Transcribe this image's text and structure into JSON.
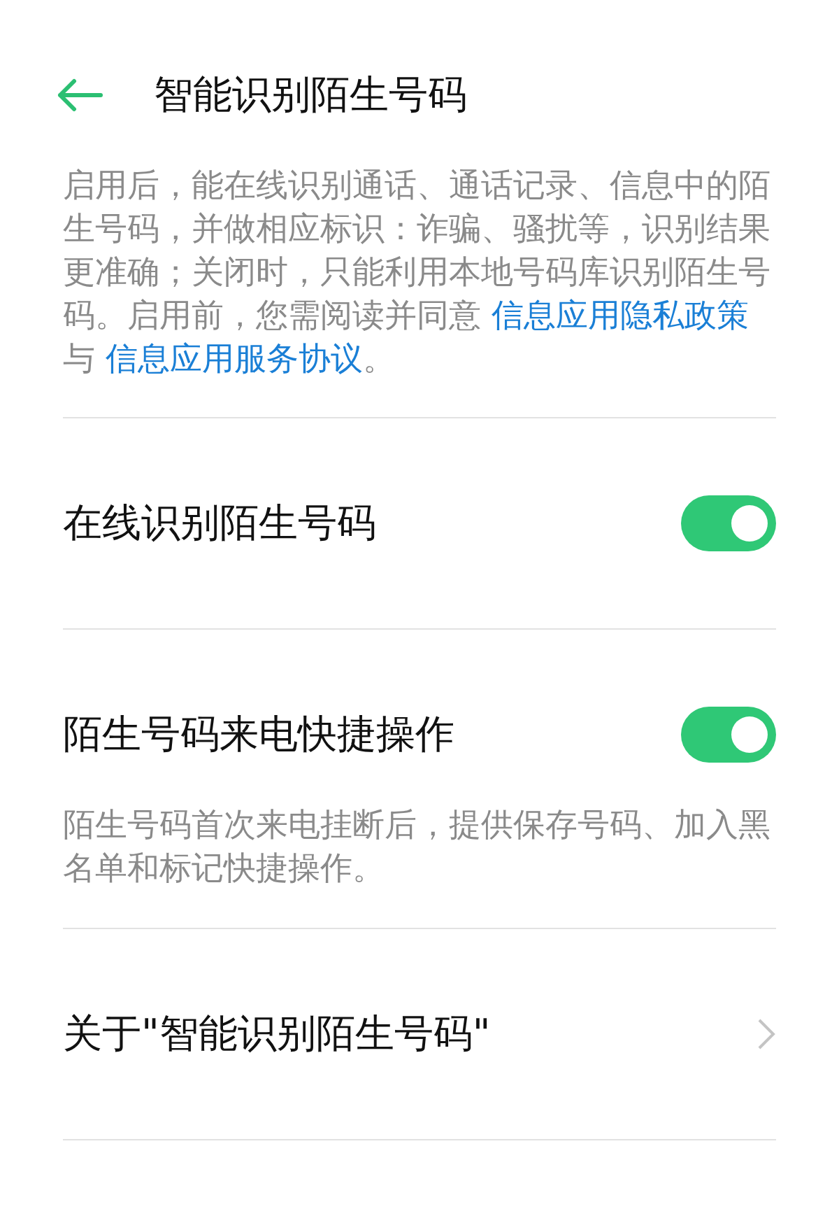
{
  "header": {
    "title": "智能识别陌生号码"
  },
  "description": [
    {
      "kind": "text",
      "text": "启用后，能在线识别通话、通话记录、信息中的陌生号码，并做相应标识：诈骗、骚扰等，识别结果更准确；关闭时，只能利用本地号码库识别陌生号码。启用前，您需阅读并同意 "
    },
    {
      "kind": "link",
      "text": "信息应用隐私政策"
    },
    {
      "kind": "text",
      "text": " 与 "
    },
    {
      "kind": "link",
      "text": "信息应用服务协议"
    },
    {
      "kind": "text",
      "text": "。"
    }
  ],
  "settings": [
    {
      "kind": "switch",
      "label": "在线识别陌生号码",
      "on": true
    },
    {
      "kind": "switch",
      "label": "陌生号码来电快捷操作",
      "on": true,
      "note": "陌生号码首次来电挂断后，提供保存号码、加入黑名单和标记快捷操作。"
    },
    {
      "kind": "link",
      "label": "关于\"智能识别陌生号码\""
    }
  ]
}
